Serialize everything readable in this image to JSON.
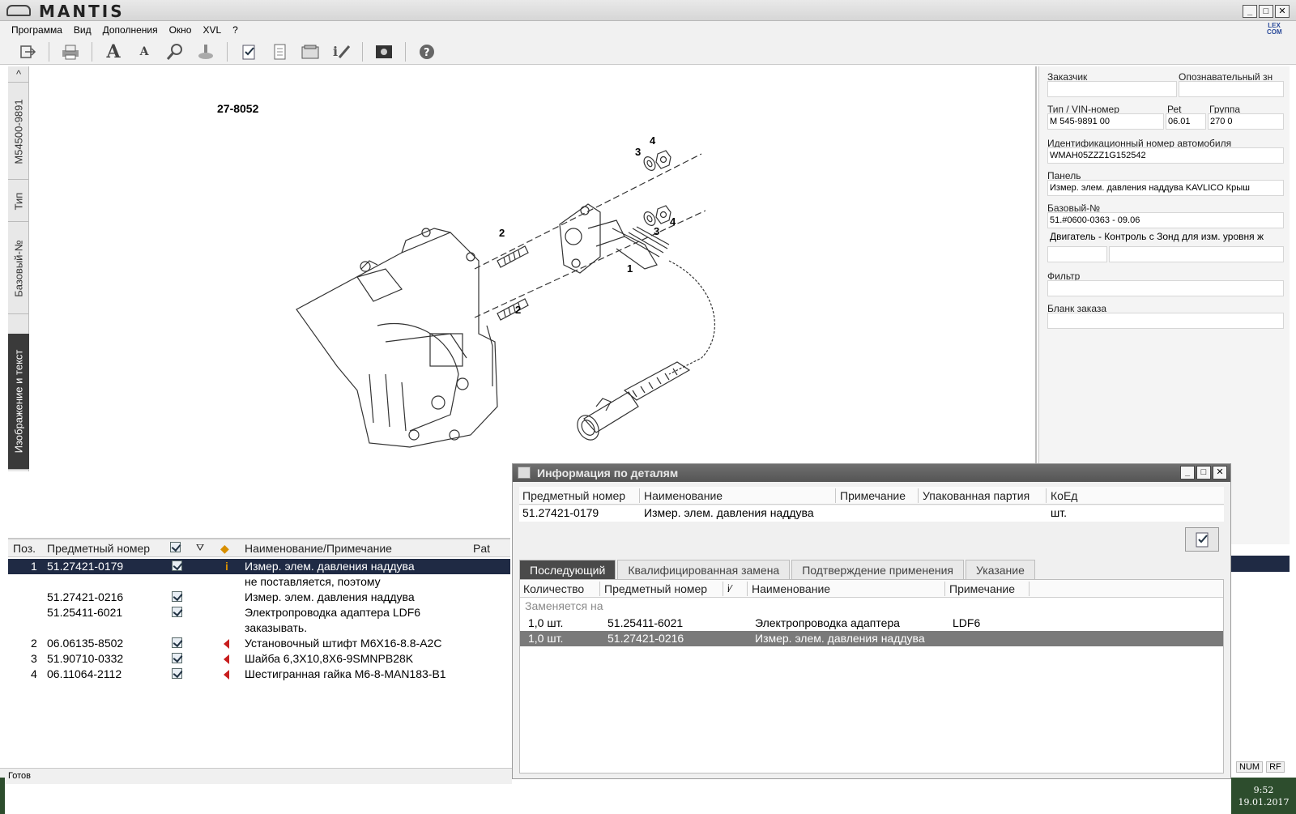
{
  "app": {
    "title": "MANTIS",
    "window_controls": [
      "_",
      "□",
      "✕"
    ]
  },
  "menu": [
    "Программа",
    "Вид",
    "Дополнения",
    "Окно",
    "XVL",
    "?"
  ],
  "vtabs": [
    "M54500-9891",
    "Тип",
    "Базовый-№",
    "Изображение и текст"
  ],
  "drawing": {
    "id": "27-8052",
    "callouts": [
      "1",
      "2",
      "2",
      "3",
      "3",
      "4",
      "4"
    ]
  },
  "right_panel": {
    "customer_label": "Заказчик",
    "ident_label": "Опознавательный зн",
    "type_vin_label": "Тип / VIN-номер",
    "type_vin_value": "M 545-9891 00",
    "ret_label": "Реt",
    "ret_value": "06.01",
    "group_label": "Группа",
    "group_value": "270 0",
    "vin_label": "Идентификационный номер автомобиля",
    "vin_value": "WMAH05ZZZ1G152542",
    "panel_label": "Панель",
    "panel_value": "Измер. элем. давления наддува  KAVLICO Крыш",
    "base_label": "Базовый-№",
    "base_value": "51.#0600-0363  - 09.06",
    "engine_value": "Двигатель - Контроль с Зонд для изм. уровня ж",
    "filter_label": "Фильтр",
    "order_label": "Бланк заказа"
  },
  "parts_list": {
    "headers": {
      "pos": "Поз.",
      "number": "Предметный номер",
      "name": "Наименование/Примечание",
      "pat": "Pat"
    },
    "rows": [
      {
        "pos": "1",
        "number": "51.27421-0179",
        "check": true,
        "flag": "info",
        "name": "Измер. элем. давления наддува",
        "selected": true
      },
      {
        "pos": "",
        "number": "",
        "check": false,
        "flag": "",
        "name": "не поставляется, поэтому",
        "selected": false
      },
      {
        "pos": "",
        "number": "51.27421-0216",
        "check": true,
        "flag": "",
        "name": "Измер. элем. давления наддува",
        "selected": false
      },
      {
        "pos": "",
        "number": "51.25411-6021",
        "check": true,
        "flag": "",
        "name": "Электропроводка адаптера LDF6",
        "selected": false
      },
      {
        "pos": "",
        "number": "",
        "check": false,
        "flag": "",
        "name": "заказывать.",
        "selected": false
      },
      {
        "pos": "2",
        "number": "06.06135-8502",
        "check": true,
        "flag": "red",
        "name": "Установочный штифт М6X16-8.8-A2C",
        "selected": false
      },
      {
        "pos": "3",
        "number": "51.90710-0332",
        "check": true,
        "flag": "red",
        "name": "Шайба 6,3X10,8X6-9SMNPB28K",
        "selected": false
      },
      {
        "pos": "4",
        "number": "06.11064-2112",
        "check": true,
        "flag": "red",
        "name": "Шестигранная гайка M6-8-MAN183-B1",
        "selected": false
      }
    ]
  },
  "status": {
    "text": "Готов",
    "num": "NUM",
    "rf": "RF",
    "time": "9:52",
    "date": "19.01.2017"
  },
  "details_dialog": {
    "title": "Информация по деталям",
    "headers": {
      "number": "Предметный номер",
      "name": "Наименование",
      "note": "Примечание",
      "packed": "Упакованная партия",
      "unit": "КоЕд"
    },
    "row": {
      "number": "51.27421-0179",
      "name": "Измер. элем. давления наддува",
      "note": "",
      "packed": "",
      "unit": "шт."
    },
    "tabs": [
      "Последующий",
      "Квалифицированная замена",
      "Подтверждение применения",
      "Указание"
    ],
    "active_tab": 0,
    "table_headers": {
      "qty": "Количество",
      "number": "Предметный номер",
      "name": "Наименование",
      "note": "Примечание"
    },
    "group_label": "Заменяется на",
    "rows": [
      {
        "qty": "1,0  шт.",
        "number": "51.25411-6021",
        "name": "Электропроводка адаптера",
        "note": "LDF6",
        "selected": false
      },
      {
        "qty": "1,0  шт.",
        "number": "51.27421-0216",
        "name": "Измер. элем. давления наддува",
        "note": "",
        "selected": true
      }
    ]
  }
}
